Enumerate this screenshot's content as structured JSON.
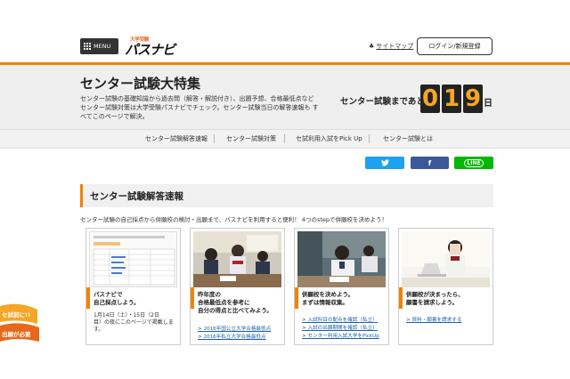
{
  "header": {
    "menu_label": "MENU",
    "logo_small": "大学受験",
    "logo_big": "パスナビ",
    "sitemap": "サイトマップ",
    "login": "ログイン/新規登録"
  },
  "hero": {
    "title": "センター試験大特集",
    "desc_lines": [
      "センター試験の基礎知識から過去問（解答・解説付き）、出題予想、合格最低点など",
      "センター試験対策は大学受験パスナビでチェック。センター試験当日の解答速報も す",
      "べてこのページで解決。"
    ],
    "countdown_label": "センター試験まであと",
    "digits": [
      "0",
      "1",
      "9"
    ],
    "day_unit": "日"
  },
  "nav": {
    "items": [
      "センター試験解答速報",
      "センター試験対策",
      "セ試利用入試をPick Up",
      "センター試験とは"
    ]
  },
  "share": {
    "twitter": "twitter-icon",
    "facebook": "f",
    "line": "LINE",
    "colors": {
      "twitter": "#1da1f2",
      "facebook": "#3b5998",
      "line": "#00b900"
    }
  },
  "section": {
    "title": "センター試験解答速報",
    "lead": "センター試験の自己採点から併願校の検討・出願まで、パスナビを利用すると便利！ 4つのstepで併願校を決めよう！"
  },
  "cards": [
    {
      "title_lines": [
        "パスナビで",
        "自己採点しよう。"
      ],
      "body_lines": [
        "1月14日（土）・15日（2日",
        "目）の夜にこのページで掲載しま",
        "す。"
      ],
      "links": [],
      "mock_heading": "1月14日（土）"
    },
    {
      "title_lines": [
        "昨年度の",
        "合格最低点を参考に",
        "自分の得点と比べてみよう。"
      ],
      "body_lines": [],
      "links": [
        "2016年国公立大学合格最低点",
        "2016年私立大学合格最低点"
      ]
    },
    {
      "title_lines": [
        "併願校を決めよう。",
        "まずは情報収集。"
      ],
      "body_lines": [],
      "links": [
        "入試科目の配点を確認（私立）",
        "入試の出願期間を確認（私立）",
        "センター利用入試大学をPickUp"
      ]
    },
    {
      "title_lines": [
        "併願校が決まったら、",
        "願書を請求しよう。"
      ],
      "body_lines": [],
      "links": [
        "資料・願書を請求する"
      ]
    }
  ],
  "badge": {
    "line1": "セ試前に!!",
    "line2": "出願が必要"
  },
  "colors": {
    "accent": "#f08300",
    "link": "#1a5fb4"
  }
}
